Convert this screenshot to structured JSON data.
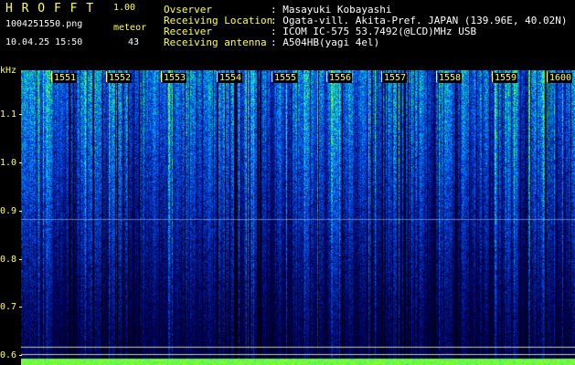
{
  "app": {
    "title": "H R O F F T",
    "version": "1.00"
  },
  "file": {
    "name": "1004251550.png",
    "datetime": "10.04.25 15:50"
  },
  "meteor": {
    "label": "meteor",
    "count": "43"
  },
  "info": {
    "labels": [
      "Ovserver",
      "Receiving Location",
      "Receiver",
      "Receiving antenna"
    ],
    "values": [
      ": Masayuki Kobayashi",
      ": Ogata-vill. Akita-Pref. JAPAN (139.96E, 40.02N)",
      ": ICOM IC-575 53.7492(@LCD)MHz USB",
      ": A504HB(yagi 4el)"
    ]
  },
  "chart_data": {
    "type": "heatmap",
    "ylabel": "kHz",
    "y_ticks": [
      "1.1",
      "1.0",
      "0.9",
      "0.8",
      "0.7",
      "0.6"
    ],
    "x_ticks": [
      "1551",
      "1552",
      "1553",
      "1554",
      "1555",
      "1556",
      "1557",
      "1558",
      "1559",
      "1600"
    ],
    "ylim": [
      0.58,
      1.19
    ]
  },
  "colors": {
    "label": "#ffff55",
    "background": "#000000",
    "noise_low": "#000a6e",
    "noise_mid": "#1e5aff",
    "noise_high": "#50ff50"
  }
}
